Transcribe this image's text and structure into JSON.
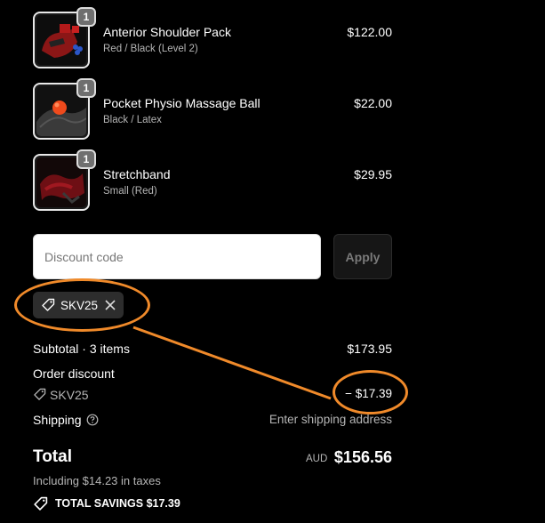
{
  "items": [
    {
      "name": "Anterior Shoulder Pack",
      "variant": "Red / Black (Level 2)",
      "price": "$122.00",
      "qty": "1",
      "image": "shoulder-pack"
    },
    {
      "name": "Pocket Physio Massage Ball",
      "variant": "Black / Latex",
      "price": "$22.00",
      "qty": "1",
      "image": "massage-ball"
    },
    {
      "name": "Stretchband",
      "variant": "Small (Red)",
      "price": "$29.95",
      "qty": "1",
      "image": "stretchband"
    }
  ],
  "discount": {
    "placeholder": "Discount code",
    "apply_label": "Apply",
    "applied_code": "SKV25"
  },
  "summary": {
    "subtotal_label": "Subtotal · 3 items",
    "subtotal_value": "$173.95",
    "order_discount_label": "Order discount",
    "discount_code": "SKV25",
    "discount_value": "− $17.39",
    "shipping_label": "Shipping",
    "shipping_value": "Enter shipping address",
    "total_label": "Total",
    "currency": "AUD",
    "total_value": "$156.56",
    "taxes_note": "Including $14.23 in taxes",
    "savings_label": "TOTAL SAVINGS",
    "savings_value": "$17.39"
  },
  "colors": {
    "background": "#000000",
    "annotation": "#f08a2a",
    "chip": "#2d2d2d"
  }
}
